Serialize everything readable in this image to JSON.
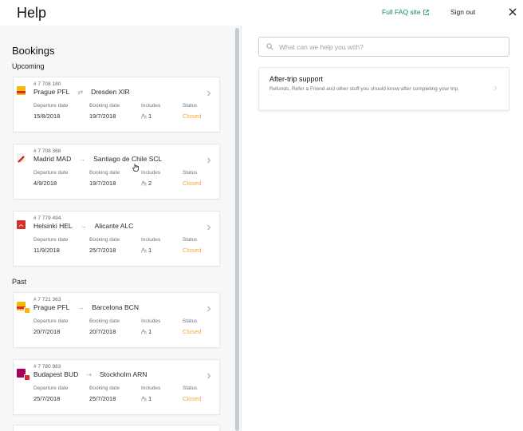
{
  "header": {
    "title": "Help",
    "faq_link": "Full FAQ site",
    "sign_out": "Sign out"
  },
  "bookings": {
    "title": "Bookings",
    "upcoming_label": "Upcoming",
    "past_label": "Past",
    "column_labels": {
      "departure": "Departure date",
      "booking": "Booking date",
      "includes": "Includes",
      "status": "Status"
    },
    "upcoming": [
      {
        "number": "# 7 708 180",
        "from": "Prague PFL",
        "to": "Dresden XIR",
        "arrow": "⇄",
        "departure": "15/8/2018",
        "booking": "19/7/2018",
        "passengers": "1",
        "status": "Closed",
        "logo_colors": [
          "#f5b90a"
        ]
      },
      {
        "number": "# 7 708 368",
        "from": "Madrid MAD",
        "to": "Santiago de Chile SCL",
        "arrow": "→",
        "departure": "4/9/2018",
        "booking": "19/7/2018",
        "passengers": "2",
        "status": "Closed",
        "logo_colors": [
          "#c8102e"
        ]
      },
      {
        "number": "# 7 779 494",
        "from": "Helsinki HEL",
        "to": "Alicante ALC",
        "arrow": "→",
        "departure": "11/9/2018",
        "booking": "25/7/2018",
        "passengers": "1",
        "status": "Closed",
        "logo_colors": [
          "#d32f2f"
        ]
      }
    ],
    "past": [
      {
        "number": "# 7 721 363",
        "from": "Prague PFL",
        "to": "Barcelona BCN",
        "arrow": "→",
        "departure": "20/7/2018",
        "booking": "20/7/2018",
        "passengers": "1",
        "status": "Closed",
        "logo_colors": [
          "#f5b90a",
          "#f5b90a"
        ]
      },
      {
        "number": "# 7 780 983",
        "from": "Budapest BUD",
        "to": "Stockholm ARN",
        "arrow": "⇢",
        "departure": "25/7/2018",
        "booking": "25/7/2018",
        "passengers": "1",
        "status": "Closed",
        "logo_colors": [
          "#a5005b",
          "#d32f2f"
        ]
      }
    ]
  },
  "search": {
    "placeholder": "What can we help you with?"
  },
  "support": {
    "title": "After-trip support",
    "description": "Refunds, Refer a Friend and other stuff you should know after completing your trip."
  },
  "colors": {
    "accent_link": "#0b8a6a",
    "status_closed": "#f2a83b"
  }
}
